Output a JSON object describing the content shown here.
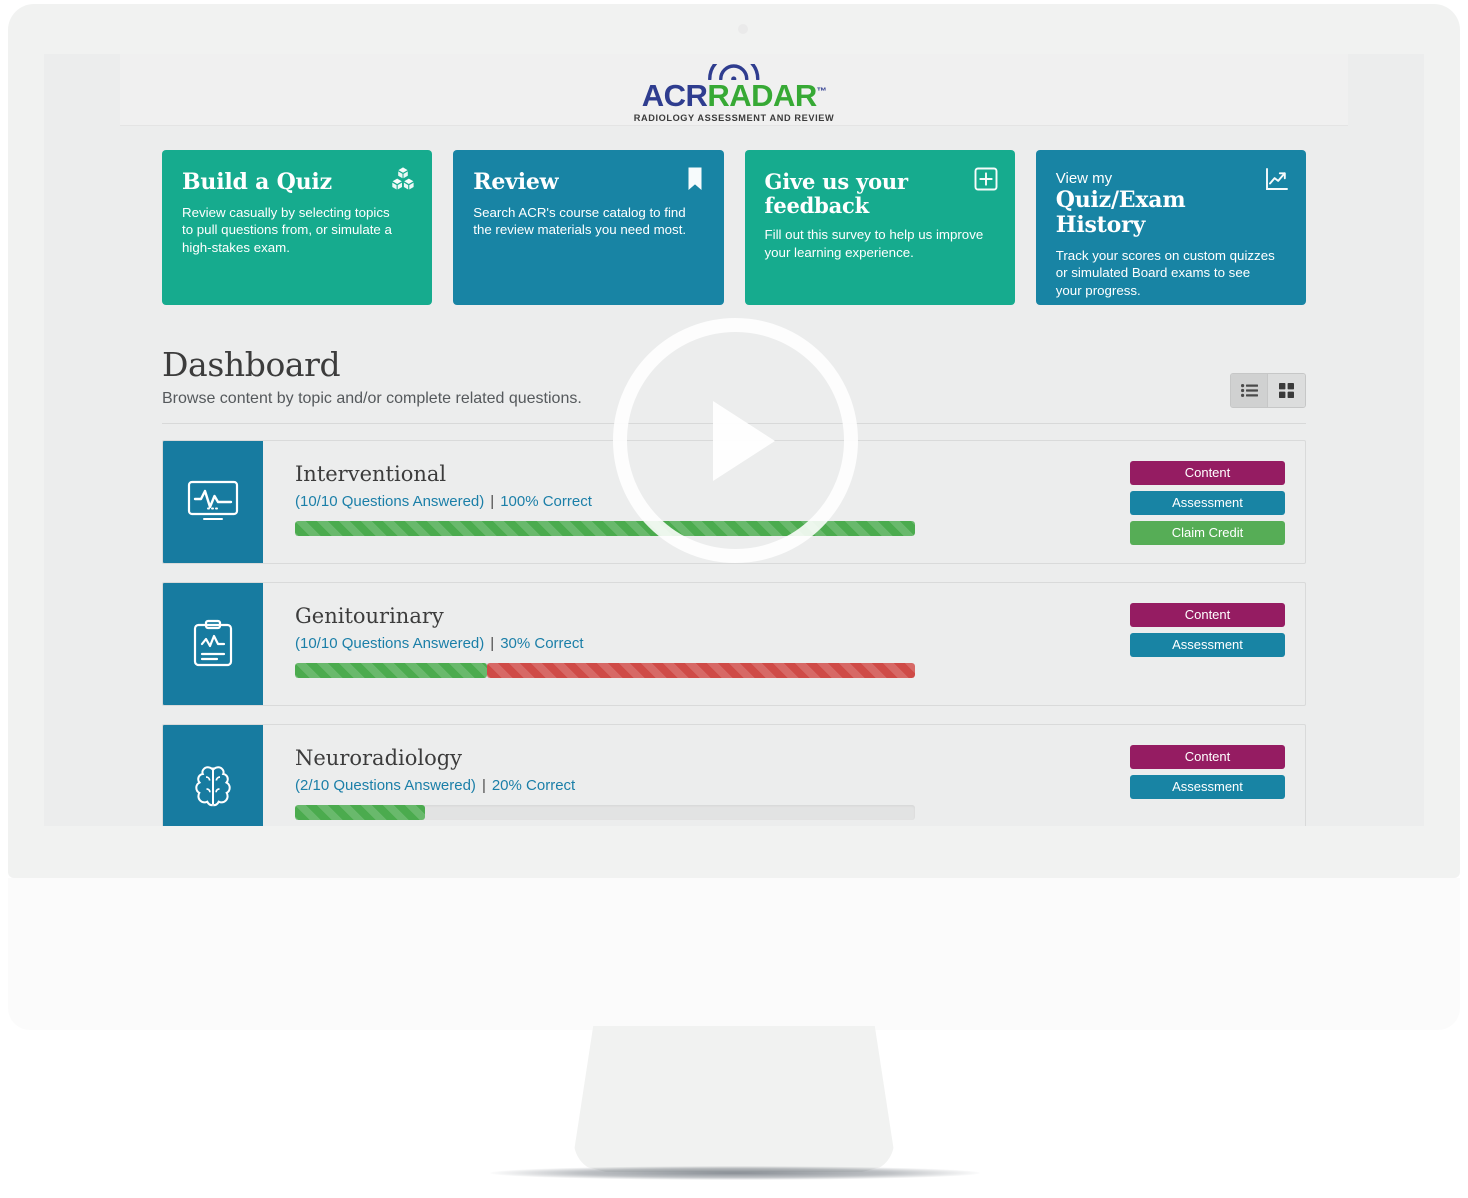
{
  "brand": {
    "name_part1": "ACR",
    "name_part2": "RADAR",
    "trademark": "™",
    "tagline": "Radiology Assessment and Review",
    "color_primary": "#2f3d8f",
    "color_secondary": "#37a935"
  },
  "tiles": [
    {
      "eyebrow": "",
      "title": "Build a Quiz",
      "description": "Review casually by selecting topics to pull questions from, or simulate a high-stakes exam.",
      "icon": "blocks-icon",
      "color": "#16ab8e"
    },
    {
      "eyebrow": "",
      "title": "Review",
      "description": "Search ACR's course catalog to find the review materials you need most.",
      "icon": "bookmark-icon",
      "color": "#1884a4"
    },
    {
      "eyebrow": "",
      "title": "Give us your feedback",
      "description": "Fill out this survey to help us improve your learning experience.",
      "icon": "plus-square-icon",
      "color": "#16ab8e"
    },
    {
      "eyebrow": "View my",
      "title": "Quiz/Exam History",
      "description": "Track your scores on custom quizzes or simulated Board exams to see your progress.",
      "icon": "chart-trend-icon",
      "color": "#1884a4"
    }
  ],
  "dashboard": {
    "title": "Dashboard",
    "subtitle": "Browse content by topic and/or complete related questions.",
    "view_modes": [
      {
        "name": "list-view",
        "icon": "list-icon",
        "active": true
      },
      {
        "name": "grid-view",
        "icon": "grid-icon",
        "active": false
      }
    ]
  },
  "topics": [
    {
      "name": "Interventional",
      "icon": "monitor-ekg-icon",
      "questions_answered": "(10/10 Questions Answered)",
      "separator": "|",
      "correct": "100% Correct",
      "progress": {
        "green_pct": 100,
        "red_pct": 0
      },
      "buttons": [
        {
          "label": "Content",
          "color": "#951c62"
        },
        {
          "label": "Assessment",
          "color": "#1884a4"
        },
        {
          "label": "Claim Credit",
          "color": "#56ad56"
        }
      ]
    },
    {
      "name": "Genitourinary",
      "icon": "clipboard-chart-icon",
      "questions_answered": "(10/10 Questions Answered)",
      "separator": "|",
      "correct": "30% Correct",
      "progress": {
        "green_pct": 30,
        "red_pct": 70
      },
      "buttons": [
        {
          "label": "Content",
          "color": "#951c62"
        },
        {
          "label": "Assessment",
          "color": "#1884a4"
        }
      ]
    },
    {
      "name": "Neuroradiology",
      "icon": "brain-icon",
      "questions_answered": "(2/10 Questions Answered)",
      "separator": "|",
      "correct": "20% Correct",
      "progress": {
        "green_pct": 21,
        "red_pct": 0
      },
      "buttons": [
        {
          "label": "Content",
          "color": "#951c62"
        },
        {
          "label": "Assessment",
          "color": "#1884a4"
        }
      ]
    }
  ],
  "overlay": {
    "play_label": "Play video"
  }
}
